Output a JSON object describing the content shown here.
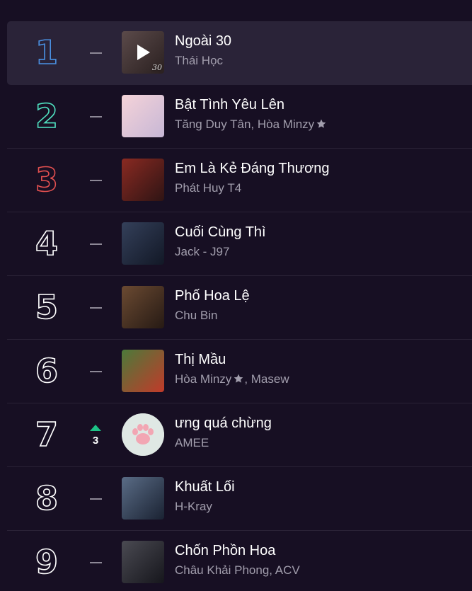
{
  "chart": {
    "rows": [
      {
        "rank": "1",
        "status": "same",
        "change": "",
        "title": "Ngoài 30",
        "artists": [
          {
            "name": "Thái Học",
            "verified": false
          }
        ],
        "cover": {
          "from": "#5b4a4a",
          "to": "#2a2020",
          "label": "30"
        }
      },
      {
        "rank": "2",
        "status": "same",
        "change": "",
        "title": "Bật Tình Yêu Lên",
        "artists": [
          {
            "name": "Tăng Duy Tân",
            "verified": false
          },
          {
            "name": "Hòa Minzy",
            "verified": true
          }
        ],
        "cover": {
          "from": "#f5d3d8",
          "to": "#c7b7d6",
          "label": ""
        }
      },
      {
        "rank": "3",
        "status": "same",
        "change": "",
        "title": "Em Là Kẻ Đáng Thương",
        "artists": [
          {
            "name": "Phát Huy T4",
            "verified": false
          }
        ],
        "cover": {
          "from": "#8a2a22",
          "to": "#2e1414",
          "label": ""
        }
      },
      {
        "rank": "4",
        "status": "same",
        "change": "",
        "title": "Cuối Cùng Thì",
        "artists": [
          {
            "name": "Jack - J97",
            "verified": false
          }
        ],
        "cover": {
          "from": "#34405a",
          "to": "#121826",
          "label": ""
        }
      },
      {
        "rank": "5",
        "status": "same",
        "change": "",
        "title": "Phố Hoa Lệ",
        "artists": [
          {
            "name": "Chu Bin",
            "verified": false
          }
        ],
        "cover": {
          "from": "#6b4a32",
          "to": "#261a14",
          "label": ""
        }
      },
      {
        "rank": "6",
        "status": "same",
        "change": "",
        "title": "Thị Mầu",
        "artists": [
          {
            "name": "Hòa Minzy",
            "verified": true
          },
          {
            "name": "Masew",
            "verified": false
          }
        ],
        "cover": {
          "from": "#4b7a3a",
          "to": "#c23a2a",
          "label": ""
        }
      },
      {
        "rank": "7",
        "status": "up",
        "change": "3",
        "title": "ưng quá chừng",
        "artists": [
          {
            "name": "AMEE",
            "verified": false
          }
        ],
        "cover": {
          "type": "paw"
        }
      },
      {
        "rank": "8",
        "status": "same",
        "change": "",
        "title": "Khuất Lối",
        "artists": [
          {
            "name": "H-Kray",
            "verified": false
          }
        ],
        "cover": {
          "from": "#5a6c86",
          "to": "#1a2232",
          "label": ""
        }
      },
      {
        "rank": "9",
        "status": "same",
        "change": "",
        "title": "Chốn Phồn Hoa",
        "artists": [
          {
            "name": "Châu Khải Phong",
            "verified": false
          },
          {
            "name": "ACV",
            "verified": false
          }
        ],
        "cover": {
          "from": "#4a4a52",
          "to": "#16161c",
          "label": ""
        }
      }
    ],
    "active_index": 0
  },
  "colors": {
    "background": "#170f23",
    "active_row": "#2a2338",
    "rank1": "#4a90e2",
    "rank2": "#50e3c2",
    "rank3": "#e35050",
    "rank_other": "#ffffff",
    "up": "#1dc186",
    "muted_text": "#a29ead"
  },
  "icons": {
    "play": "play-icon",
    "star": "star-icon",
    "same": "dash-icon",
    "up": "arrow-up-icon",
    "paw": "paw-icon"
  }
}
